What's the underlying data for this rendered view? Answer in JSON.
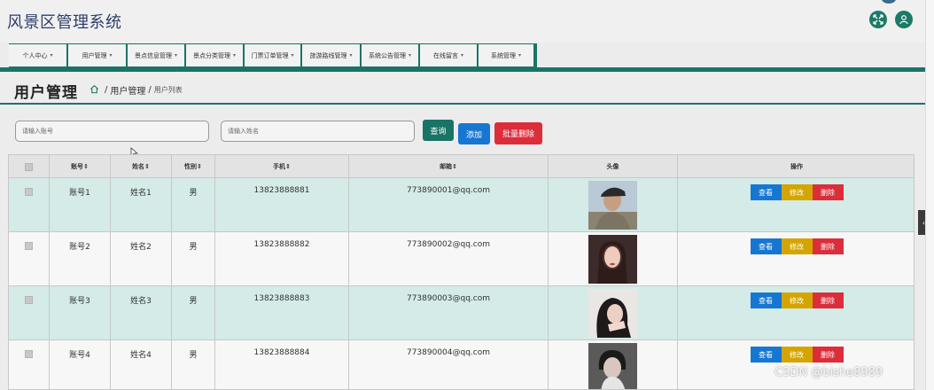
{
  "app": {
    "title": "风景区管理系统"
  },
  "menu": [
    {
      "label": "个人中心"
    },
    {
      "label": "用户管理"
    },
    {
      "label": "景点信息管理"
    },
    {
      "label": "景点分类管理"
    },
    {
      "label": "门票订单管理"
    },
    {
      "label": "旅游路线管理"
    },
    {
      "label": "系统公告管理"
    },
    {
      "label": "在线留言"
    },
    {
      "label": "系统管理"
    }
  ],
  "page": {
    "title": "用户管理",
    "breadcrumb": {
      "section": "用户管理",
      "current": "用户列表",
      "separator": "/"
    }
  },
  "search": {
    "account_placeholder": "请输入账号",
    "name_placeholder": "请输入姓名",
    "query_label": "查询",
    "add_label": "添加",
    "batch_delete_label": "批量删除"
  },
  "table": {
    "columns": [
      "账号",
      "姓名",
      "性别",
      "手机",
      "邮箱",
      "头像",
      "操作"
    ],
    "sort_mark": "⇕",
    "rows": [
      {
        "account": "账号1",
        "name": "姓名1",
        "gender": "男",
        "phone": "13823888881",
        "email": "773890001@qq.com"
      },
      {
        "account": "账号2",
        "name": "姓名2",
        "gender": "男",
        "phone": "13823888882",
        "email": "773890002@qq.com"
      },
      {
        "account": "账号3",
        "name": "姓名3",
        "gender": "男",
        "phone": "13823888883",
        "email": "773890003@qq.com"
      },
      {
        "account": "账号4",
        "name": "姓名4",
        "gender": "男",
        "phone": "13823888884",
        "email": "773890004@qq.com"
      }
    ],
    "actions": {
      "view": "查看",
      "edit": "修改",
      "delete": "删除"
    }
  },
  "watermark": "CSDN @bishe8989",
  "colors": {
    "primary_green": "#1a7466",
    "view_blue": "#1677d2",
    "edit_yellow": "#d4a500",
    "delete_red": "#dc2d3a",
    "row_highlight": "#d4ebe7"
  },
  "icons": {
    "fullscreen": "fullscreen-icon",
    "user": "user-icon",
    "home": "home-icon",
    "sidebar_toggle": "chevron-left-icon"
  }
}
